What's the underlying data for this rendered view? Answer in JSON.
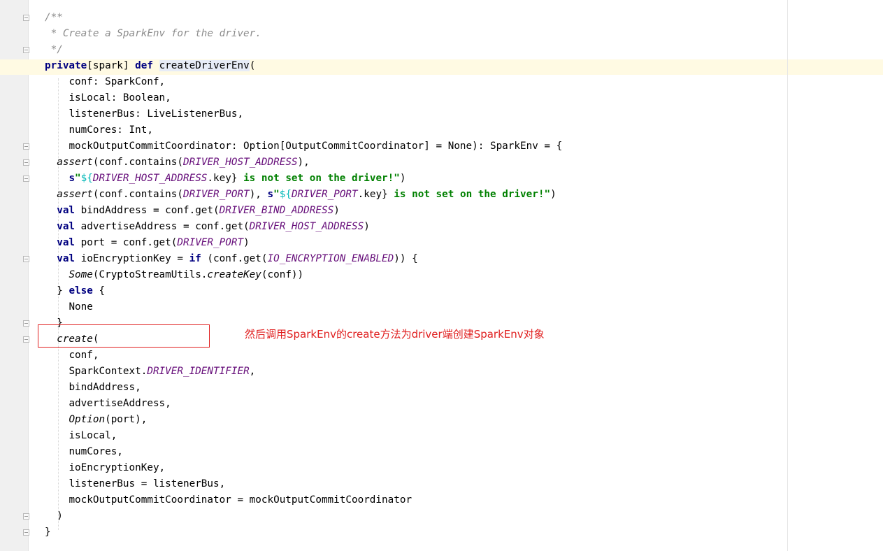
{
  "code": {
    "comment_start": "/**",
    "comment_text": " * Create a SparkEnv for the driver.",
    "comment_end": " */",
    "kw_private": "private",
    "spark_scope": "[spark] ",
    "kw_def": "def",
    "method_name": "createDriverEnv",
    "open_paren": "(",
    "param_conf": "conf: SparkConf,",
    "param_islocal": "isLocal: Boolean,",
    "param_listenerbus": "listenerBus: LiveListenerBus,",
    "param_numcores": "numCores: Int,",
    "param_mock": "mockOutputCommitCoordinator: Option[OutputCommitCoordinator] = None): SparkEnv = {",
    "assert": "assert",
    "conf_contains": "(conf.contains(",
    "driver_host_address": "DRIVER_HOST_ADDRESS",
    "close_comma": "),",
    "s_prefix": "s",
    "quote_open": "\"",
    "interp_open": "${",
    "key_close": ".key}",
    "not_set_msg": " is not set on the driver!\"",
    "close_paren": ")",
    "driver_port": "DRIVER_PORT",
    "close_paren_comma_space": "), ",
    "kw_val": "val",
    "bind_address_decl": " bindAddress = conf.get(",
    "driver_bind_address": "DRIVER_BIND_ADDRESS",
    "advertise_decl": " advertiseAddress = conf.get(",
    "port_decl": " port = conf.get(",
    "io_key_decl": " ioEncryptionKey = ",
    "kw_if": "if",
    "conf_get_open": " (conf.get(",
    "io_encryption_enabled": "IO_ENCRYPTION_ENABLED",
    "if_close": ")) {",
    "some": "Some",
    "crypto_utils": "(CryptoStreamUtils.",
    "create_key": "createKey",
    "conf_arg_close": "(conf))",
    "close_brace": "}",
    "close_brace_space": "} ",
    "kw_else": "else",
    "open_brace_tail": " {",
    "none_value": "None",
    "create_call": "create",
    "arg_conf": "conf,",
    "spark_context": "SparkContext.",
    "driver_identifier": "DRIVER_IDENTIFIER",
    "comma": ",",
    "arg_bind": "bindAddress,",
    "arg_advertise": "advertiseAddress,",
    "option": "Option",
    "port_arg": "(port),",
    "arg_islocal": "isLocal,",
    "arg_numcores": "numCores,",
    "arg_io": "ioEncryptionKey,",
    "arg_listener": "listenerBus = listenerBus,",
    "arg_mock": "mockOutputCommitCoordinator = mockOutputCommitCoordinator"
  },
  "annotation": {
    "text": "然后调用SparkEnv的create方法为driver端创建SparkEnv对象",
    "color": "#e01e1e"
  },
  "colors": {
    "keyword": "#000080",
    "string": "#008000",
    "constant": "#660e7a",
    "comment": "#8c8c8c",
    "caret_row": "#fffae3",
    "highlight": "#e7ecf7"
  }
}
